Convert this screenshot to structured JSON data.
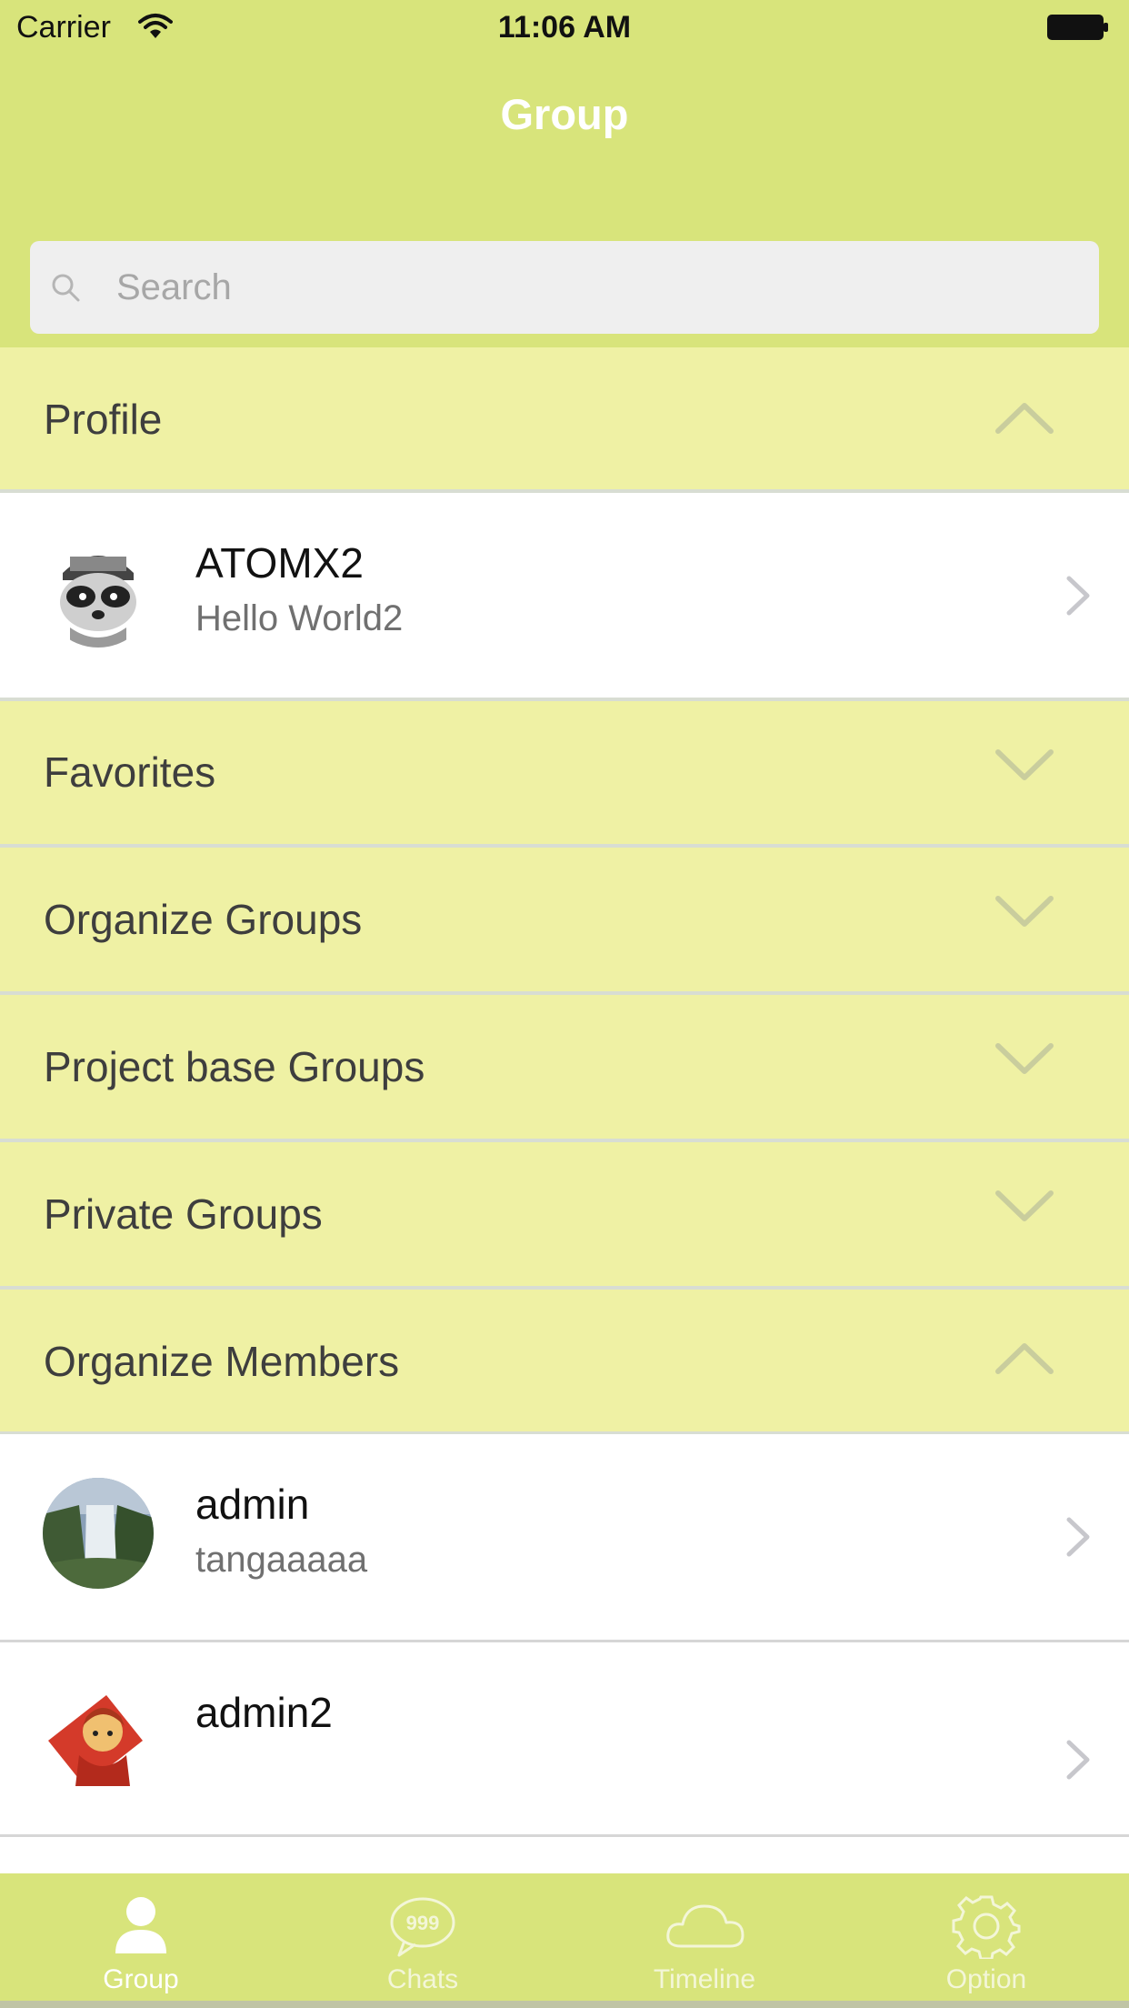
{
  "status_bar": {
    "carrier": "Carrier",
    "time": "11:06 AM"
  },
  "nav": {
    "title": "Group"
  },
  "search": {
    "placeholder": "Search"
  },
  "sections": {
    "profile": {
      "label": "Profile",
      "expanded": true
    },
    "favorites": {
      "label": "Favorites",
      "expanded": false
    },
    "organize_groups": {
      "label": "Organize Groups",
      "expanded": false
    },
    "project_base_groups": {
      "label": "Project base Groups",
      "expanded": false
    },
    "private_groups": {
      "label": "Private Groups",
      "expanded": false
    },
    "organize_members": {
      "label": "Organize Members",
      "expanded": true
    }
  },
  "profile_row": {
    "name": "ATOMX2",
    "status": "Hello World2",
    "avatar": "raccoon-avatar"
  },
  "members": [
    {
      "name": "admin",
      "status": "tangaaaaa",
      "avatar": "waterfall-avatar"
    },
    {
      "name": "admin2",
      "status": "",
      "avatar": "cartoon-warrior-avatar"
    }
  ],
  "tabs": [
    {
      "label": "Group",
      "icon": "person-icon",
      "active": true
    },
    {
      "label": "Chats",
      "icon": "chat-bubble-icon",
      "badge": "999",
      "active": false
    },
    {
      "label": "Timeline",
      "icon": "cloud-icon",
      "active": false
    },
    {
      "label": "Option",
      "icon": "gear-icon",
      "active": false
    }
  ],
  "colors": {
    "header": "#d8e47b",
    "section_bg": "#eff1a4",
    "tabbar": "#d8e47b",
    "row_bg": "#ffffff"
  }
}
